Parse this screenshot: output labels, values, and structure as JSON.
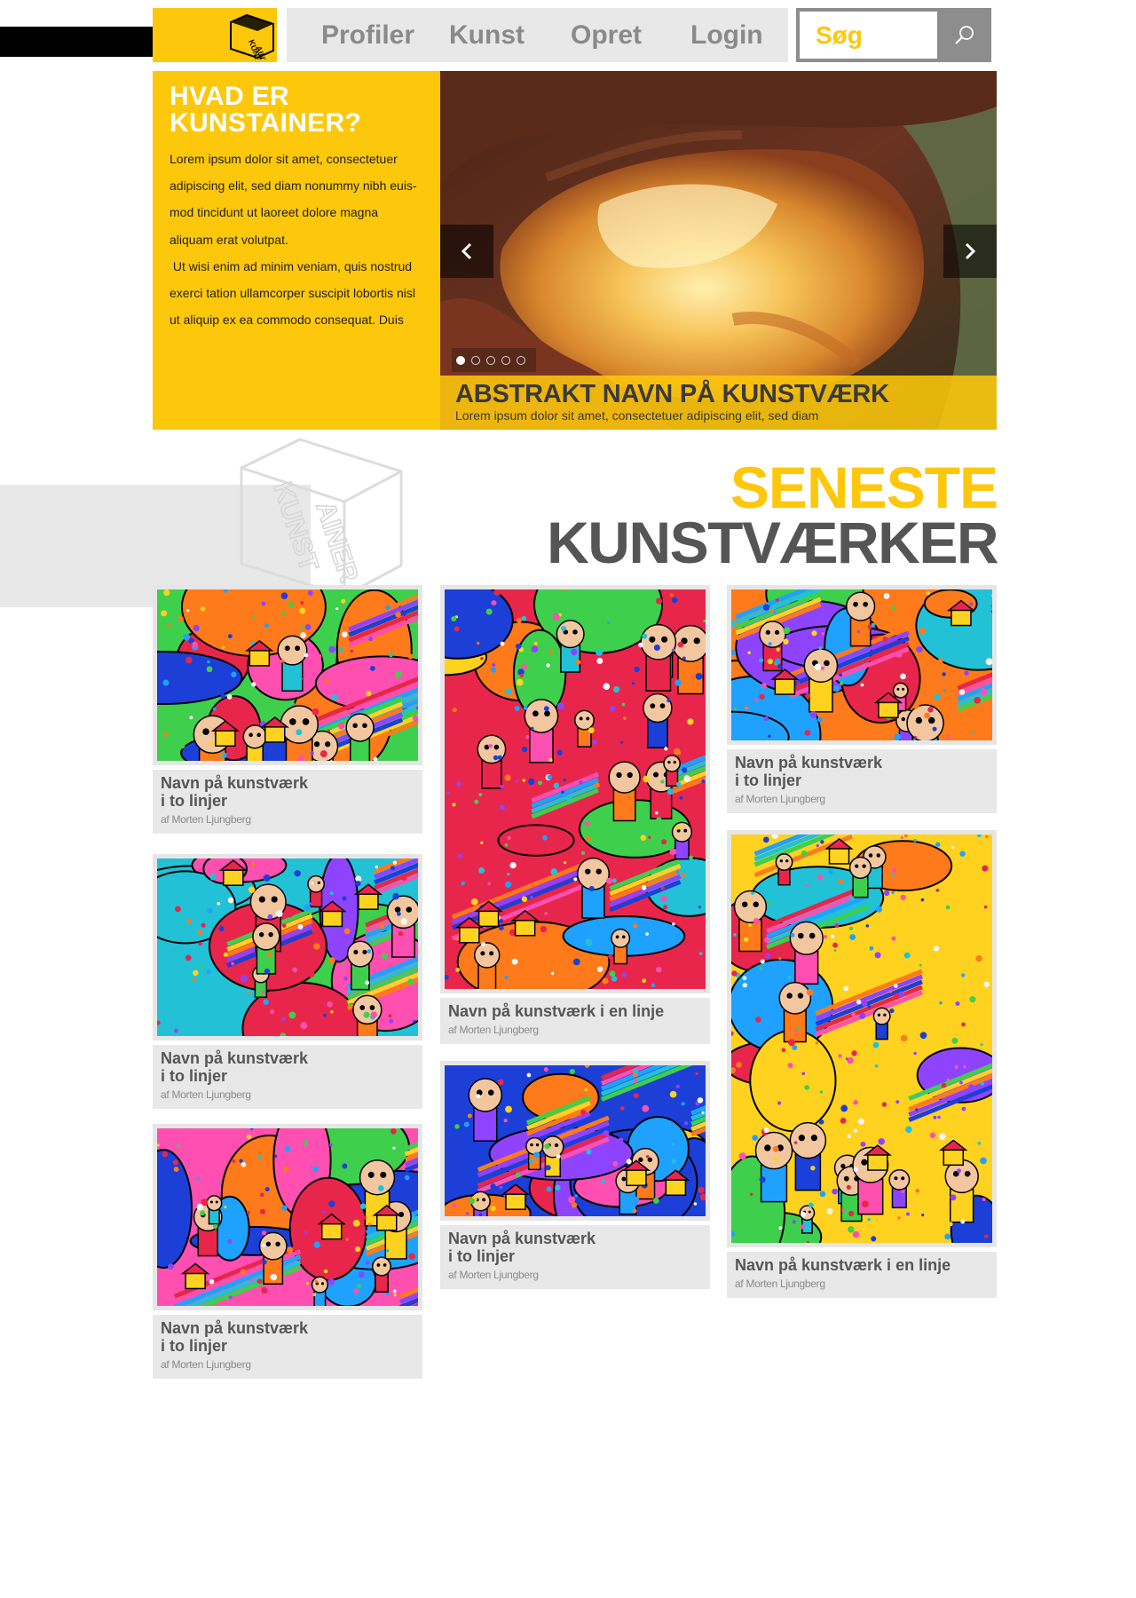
{
  "header": {
    "nav": [
      {
        "label": "Profiler"
      },
      {
        "label": "Kunst"
      },
      {
        "label": "Opret"
      },
      {
        "label": "Login"
      }
    ],
    "search": {
      "placeholder": "Søg"
    },
    "logo_text": [
      "KUNST",
      "AINER"
    ]
  },
  "intro": {
    "title_line1": "HVAD ER",
    "title_line2": "KUNSTAINER?",
    "body": "Lorem ipsum dolor sit amet, consectetuer adipiscing elit, sed diam nonummy nibh euis-mod tincidunt ut laoreet dolore magna aliquam erat volutpat.\n Ut wisi enim ad minim veniam, quis nostrud exerci tation ullamcorper suscipit lobortis nisl ut aliquip ex ea commodo consequat. Duis"
  },
  "slider": {
    "title": "ABSTRAKT NAVN PÅ KUNSTVÆRK",
    "subtitle": "Lorem ipsum dolor sit amet, consectetuer adipiscing elit, sed diam",
    "slide_count": 5,
    "active_slide": 1
  },
  "latest": {
    "heading_line1": "SENESTE",
    "heading_line2": "KUNSTVÆRKER",
    "watermark_text": [
      "KUNST",
      "AINER"
    ],
    "cards": [
      {
        "title": "Navn på kunstværk\ni to linjer",
        "artist": "af Morten Ljungberg"
      },
      {
        "title": "Navn på kunstværk\ni to linjer",
        "artist": "af Morten Ljungberg"
      },
      {
        "title": "Navn på kunstværk\ni to linjer",
        "artist": "af Morten Ljungberg"
      },
      {
        "title": "Navn på kunstværk i en linje",
        "artist": "af Morten Ljungberg"
      },
      {
        "title": "Navn på kunstværk\ni to linjer",
        "artist": "af Morten Ljungberg"
      },
      {
        "title": "Navn på kunstværk\ni to linjer",
        "artist": "af Morten Ljungberg"
      },
      {
        "title": "Navn på kunstværk i en linje",
        "artist": "af Morten Ljungberg"
      }
    ]
  },
  "colors": {
    "accent_yellow": "#fdc70c",
    "dark_gray": "#555555",
    "light_gray": "#e8e8e8"
  }
}
